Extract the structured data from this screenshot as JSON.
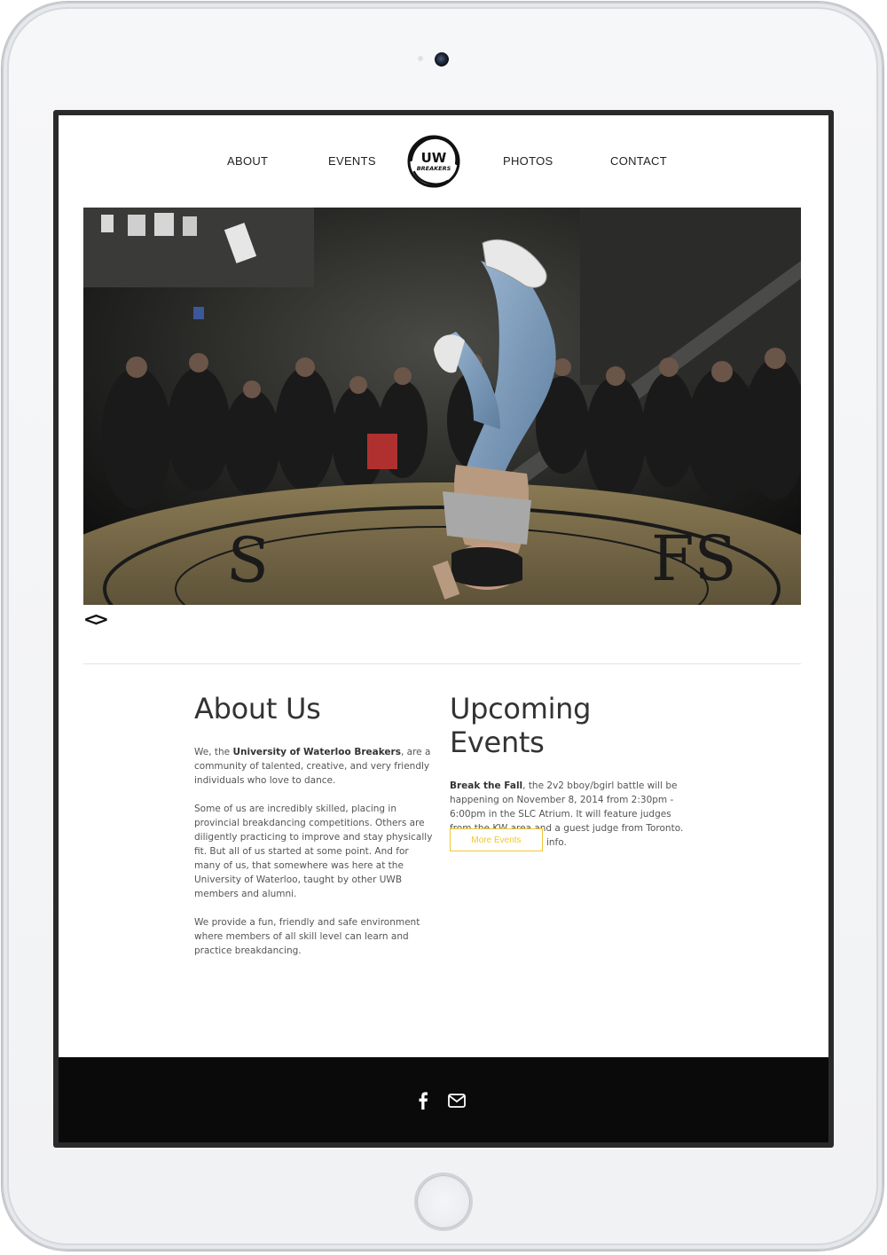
{
  "nav": {
    "items": [
      "ABOUT",
      "EVENTS",
      "PHOTOS",
      "CONTACT"
    ],
    "logo_text_top": "UW",
    "logo_text_bottom": "BREAKERS"
  },
  "hero": {
    "image": "breakdancer-freeze-photo",
    "prev_label": "<",
    "next_label": ">"
  },
  "about": {
    "title": "About Us",
    "p1_prefix": "We, the ",
    "p1_bold": "University of Waterloo Breakers",
    "p1_suffix": ", are a community of talented, creative, and very friendly individuals who love to dance.",
    "p2": "Some of us are incredibly skilled, placing in provincial breakdancing competitions. Others are diligently practicing to improve and stay physically fit. But all of us started at some point. And for many of us, that somewhere was here at the University of Waterloo, taught by other UWB members and alumni.",
    "p3": "We provide a fun, friendly and safe environment where members of all skill level can learn and practice breakdancing."
  },
  "events": {
    "title": "Upcoming Events",
    "bold": "Break the Fall",
    "text": ", the 2v2 bboy/bgirl battle will be happening on November 8, 2014 from 2:30pm - 6:00pm in the SLC Atrium. It will feature judges from the KW area and a guest judge from Toronto. Stay tuned for more info.",
    "button": "More Events"
  },
  "footer": {
    "icons": [
      "facebook-icon",
      "email-icon"
    ]
  },
  "colors": {
    "accent": "#f2c530",
    "footer_bg": "#0a0a0a",
    "text": "#555555"
  }
}
